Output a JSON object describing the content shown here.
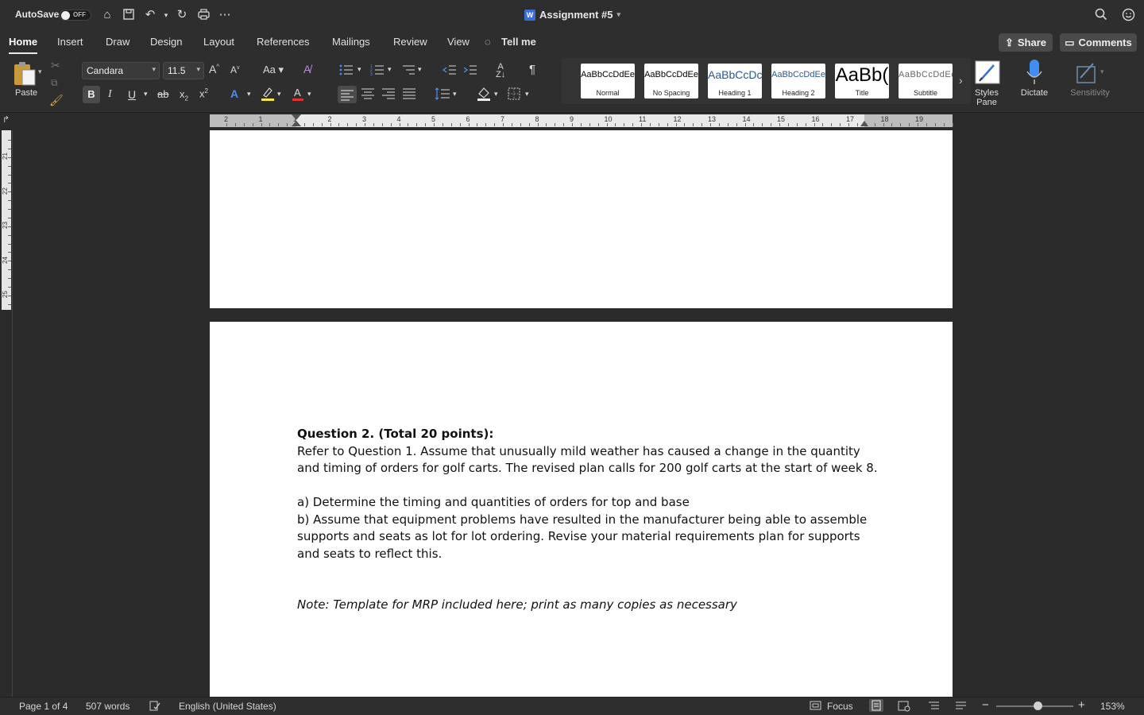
{
  "titlebar": {
    "autosave_label": "AutoSave",
    "autosave_state": "OFF",
    "document_title": "Assignment #5",
    "doc_icon_letter": "W"
  },
  "tabs": [
    "Home",
    "Insert",
    "Draw",
    "Design",
    "Layout",
    "References",
    "Mailings",
    "Review",
    "View",
    "Tell me"
  ],
  "active_tab": "Home",
  "actions": {
    "share": "Share",
    "comments": "Comments"
  },
  "ribbon": {
    "paste_label": "Paste",
    "font_name": "Candara",
    "font_size": "11.5",
    "styles": [
      {
        "sample": "AaBbCcDdEe",
        "name": "Normal"
      },
      {
        "sample": "AaBbCcDdEe",
        "name": "No Spacing"
      },
      {
        "sample": "AaBbCcDc",
        "name": "Heading 1"
      },
      {
        "sample": "AaBbCcDdEe",
        "name": "Heading 2"
      },
      {
        "sample": "AaBb(",
        "name": "Title"
      },
      {
        "sample": "AaBbCcDdEe",
        "name": "Subtitle"
      }
    ],
    "styles_pane_label": "Styles\nPane",
    "dictate_label": "Dictate",
    "sensitivity_label": "Sensitivity"
  },
  "ruler": {
    "h_ticks": [
      "2",
      "1",
      "1",
      "2",
      "3",
      "4",
      "5",
      "6",
      "7",
      "8",
      "9",
      "10",
      "11",
      "12",
      "13",
      "14",
      "15",
      "16",
      "17",
      "18",
      "19"
    ],
    "v_ticks": [
      "21",
      "22",
      "23",
      "24",
      "25"
    ]
  },
  "document": {
    "heading": "Question 2. (Total 20 points):",
    "para1": "Refer to Question 1. Assume that unusually mild weather has caused a change in the quantity and timing of orders for golf carts. The revised plan calls for 200 golf carts at the start of week 8.",
    "item_a": "a) Determine the timing and quantities of orders for top and base",
    "item_b": "b) Assume that equipment problems have resulted in the manufacturer being able to assemble supports and seats as lot for lot ordering. Revise your material requirements plan for supports and seats to reflect this.",
    "note": "Note: Template for MRP included here; print as many copies as necessary"
  },
  "status": {
    "page": "Page 1 of 4",
    "words": "507 words",
    "language": "English (United States)",
    "focus": "Focus",
    "zoom": "153%"
  },
  "colors": {
    "chrome": "#2e2e2e",
    "canvas": "#2b2b2b",
    "page": "#ffffff",
    "accent_blue": "#3b6fd8"
  }
}
